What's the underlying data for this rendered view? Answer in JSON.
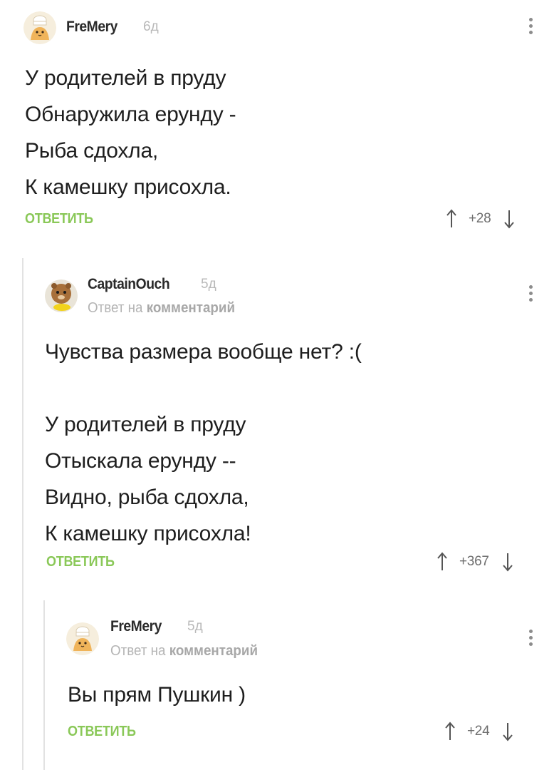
{
  "comments": [
    {
      "author": "FreMery",
      "time": "6д",
      "reply_to_prefix": "",
      "reply_to_link": "",
      "text": "У родителей в пруду\nОбнаружила ерунду -\nРыба сдохла,\nК камешку присохла.",
      "reply_label": "ОТВЕТИТЬ",
      "score": "+28",
      "avatar_icon": "chef-cat-avatar"
    },
    {
      "author": "CaptainOuch",
      "time": "5д",
      "reply_to_prefix": "Ответ на",
      "reply_to_link": "комментарий",
      "text": "Чувства размера вообще нет? :(\n\nУ родителей в пруду\nОтыскала ерунду --\nВидно, рыба сдохла,\nК камешку присохла!",
      "reply_label": "ОТВЕТИТЬ",
      "score": "+367",
      "avatar_icon": "hamster-avatar"
    },
    {
      "author": "FreMery",
      "time": "5д",
      "reply_to_prefix": "Ответ на",
      "reply_to_link": "комментарий",
      "text": "Вы прям Пушкин )",
      "reply_label": "ОТВЕТИТЬ",
      "score": "+24",
      "avatar_icon": "chef-cat-avatar"
    }
  ],
  "colors": {
    "reply_green": "#8ac858",
    "thread_line": "#e2e2e2",
    "muted": "#b4b4b4"
  }
}
